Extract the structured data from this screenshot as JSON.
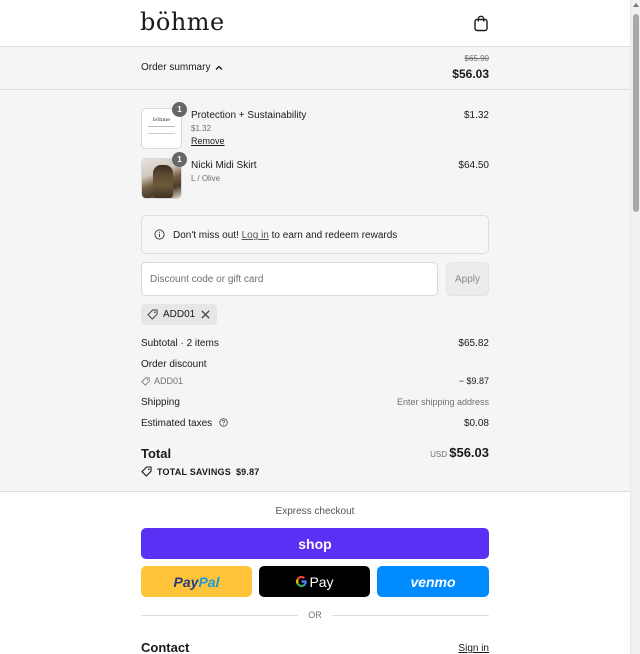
{
  "brand": {
    "logo_text": "böhme"
  },
  "summary": {
    "toggle_label": "Order summary",
    "original_total": "$65.90",
    "total": "$56.03"
  },
  "items": [
    {
      "name": "Protection + Sustainability",
      "sub": "$1.32",
      "action": "Remove",
      "price": "$1.32",
      "qty": "1",
      "thumb_logo": "böhme",
      "icon": "protection-card-image"
    },
    {
      "name": "Nicki Midi Skirt",
      "sub": "L / Olive",
      "price": "$64.50",
      "qty": "1",
      "icon": "skirt-product-image"
    }
  ],
  "rewards": {
    "prefix": "Don't miss out!",
    "link": "Log in",
    "suffix": "to earn and redeem rewards"
  },
  "discount": {
    "placeholder": "Discount code or gift card",
    "value": "",
    "apply_label": "Apply",
    "applied_code": "ADD01"
  },
  "totals": {
    "subtotal_label": "Subtotal · 2 items",
    "subtotal_value": "$65.82",
    "order_discount_label": "Order discount",
    "discount_code": "ADD01",
    "discount_value": "− $9.87",
    "shipping_label": "Shipping",
    "shipping_value": "Enter shipping address",
    "taxes_label": "Estimated taxes",
    "taxes_value": "$0.08",
    "total_label": "Total",
    "currency": "USD",
    "total_value": "$56.03",
    "savings_label": "TOTAL SAVINGS",
    "savings_value": "$9.87"
  },
  "express": {
    "label": "Express checkout",
    "shop_label": "shop",
    "paypal_part1": "Pay",
    "paypal_part2": "Pal",
    "gpay_label": "Pay",
    "venmo_label": "venmo",
    "or_label": "OR"
  },
  "contact": {
    "title": "Contact",
    "sign_in": "Sign in"
  },
  "colors": {
    "shop": "#5a31f4",
    "paypal": "#ffc439",
    "venmo": "#008cff",
    "panel": "#f5f5f5"
  }
}
